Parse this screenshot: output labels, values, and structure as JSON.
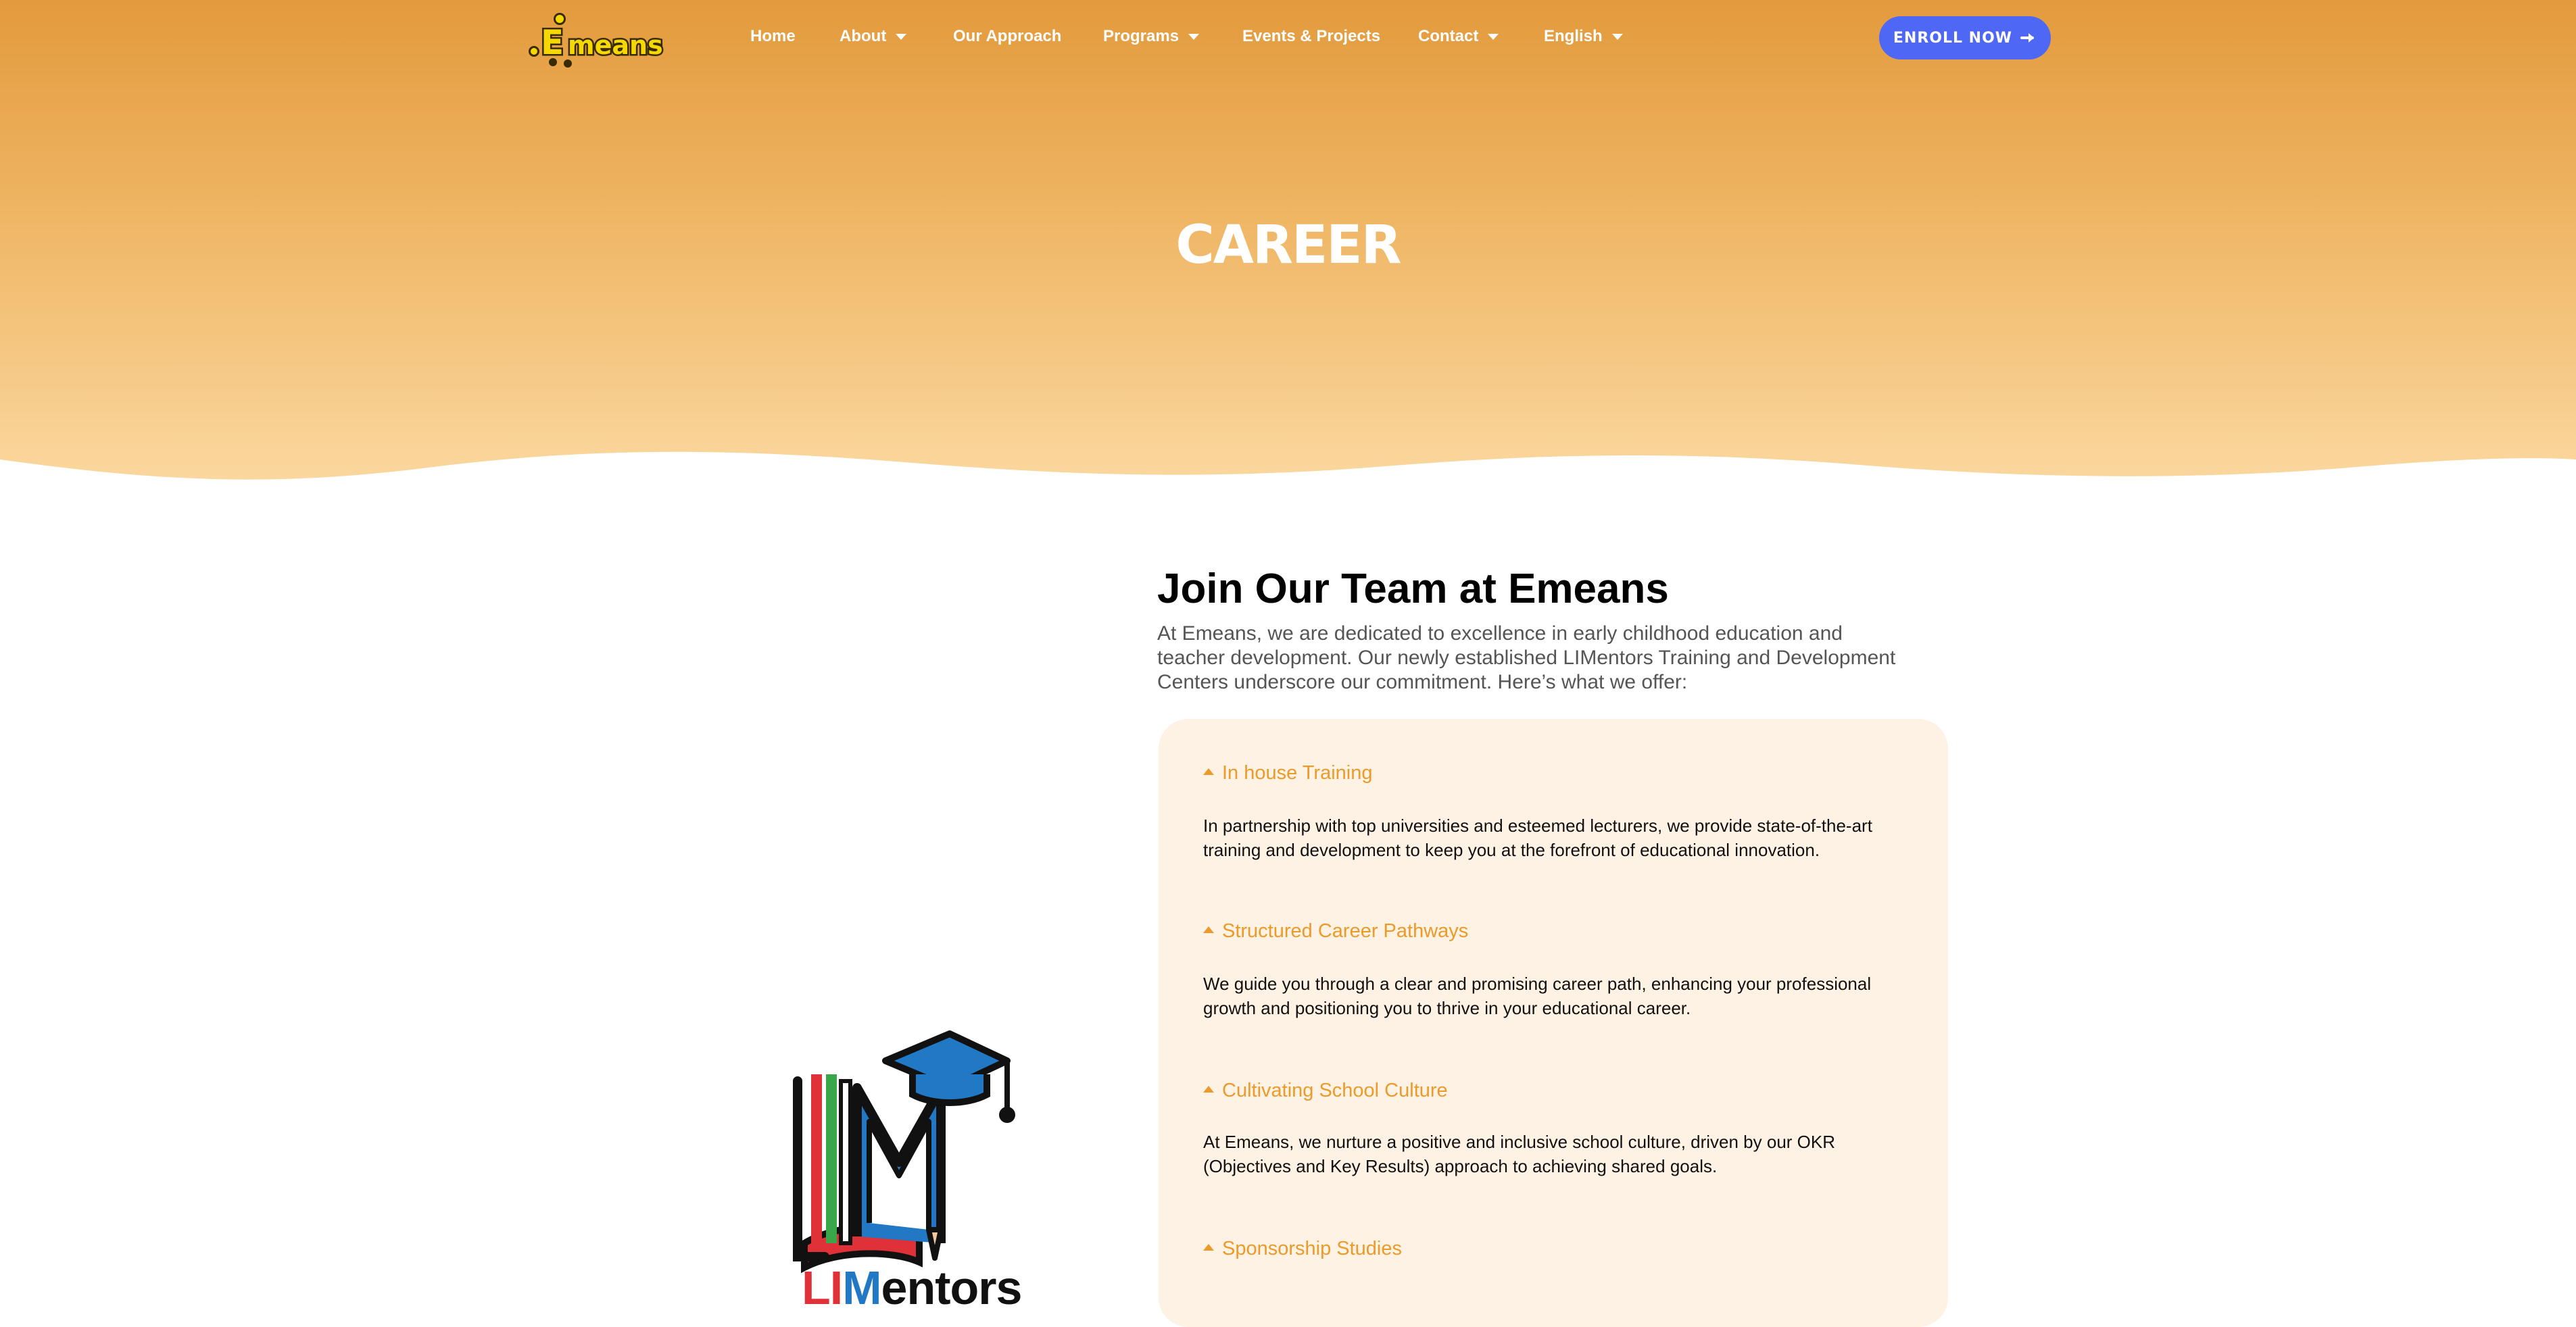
{
  "brand": {
    "logo_text": "Emeans",
    "accent": "#e39a3c",
    "cta_color": "#4f67f5",
    "accordion_color": "#ec9a2a"
  },
  "nav": {
    "items": [
      {
        "label": "Home",
        "has_dropdown": false
      },
      {
        "label": "About",
        "has_dropdown": true
      },
      {
        "label": "Our Approach",
        "has_dropdown": false
      },
      {
        "label": "Programs",
        "has_dropdown": true
      },
      {
        "label": "Events & Projects",
        "has_dropdown": false
      },
      {
        "label": "Contact",
        "has_dropdown": true
      },
      {
        "label": "English",
        "has_dropdown": true
      }
    ],
    "cta_label": "Enroll Now",
    "cta_icon": "arrow-right-icon"
  },
  "hero": {
    "title": "CAREER"
  },
  "main": {
    "heading": "Join Our Team at Emeans",
    "intro": "At Emeans, we are dedicated to excellence in early childhood education and teacher development. Our newly established LIMentors Training and Development Centers underscore our commitment. Here’s what we offer:",
    "accordion": [
      {
        "title": "In house Training",
        "body": "In partnership with top universities and esteemed lecturers, we provide state-of-the-art training and development to keep you at the forefront of educational innovation."
      },
      {
        "title": "Structured Career Pathways",
        "body": "We guide you through a clear and promising career path, enhancing your professional growth and positioning you to thrive in your educational career."
      },
      {
        "title": "Cultivating School Culture",
        "body": "At Emeans, we nurture a positive and inclusive school culture, driven by our OKR (Objectives and Key Results) approach to achieving shared goals."
      },
      {
        "title": "Sponsorship Studies",
        "body": ""
      }
    ]
  },
  "limentors": {
    "text_part1": "LI",
    "text_part2": "M",
    "text_part3": "entors"
  }
}
